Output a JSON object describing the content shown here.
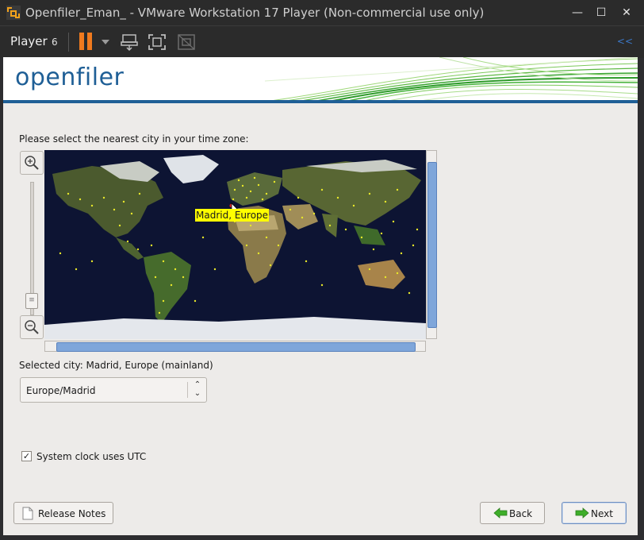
{
  "window": {
    "title": "Openfiler_Eman_ - VMware Workstation 17 Player (Non-commercial use only)",
    "controls": {
      "minimize": "—",
      "maximize": "☐",
      "close": "✕"
    }
  },
  "toolbar": {
    "player_label": "Player",
    "player_count": "6",
    "icons": [
      "pause-icon",
      "send-keys-icon",
      "fullscreen-icon",
      "unity-icon"
    ],
    "accent": "#f07a1e"
  },
  "installer": {
    "logo": "openfiler",
    "prompt": "Please select the nearest city in your time zone:",
    "map_tooltip": "Madrid, Europe",
    "selected_city_label": "Selected city: Madrid, Europe (mainland)",
    "timezone_value": "Europe/Madrid",
    "utc_checkbox": {
      "label": "System clock uses UTC",
      "checked": true
    },
    "buttons": {
      "release_notes": "Release Notes",
      "back": "Back",
      "next": "Next"
    },
    "brand_color": "#1f5f96"
  }
}
